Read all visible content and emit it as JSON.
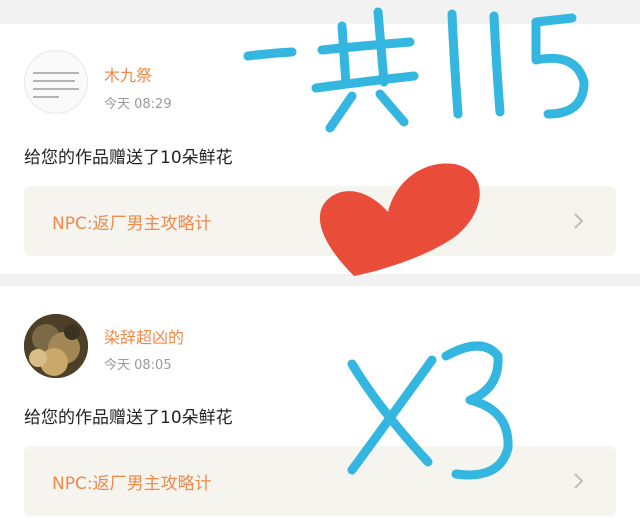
{
  "notifications": [
    {
      "username": "木九祭",
      "time": "今天 08:29",
      "message": "给您的作品赠送了10朵鲜花",
      "work_title": "NPC:返厂男主攻略计",
      "avatar_icon": "text-image-avatar"
    },
    {
      "username": "染辞超凶的",
      "time": "今天 08:05",
      "message": "给您的作品赠送了10朵鲜花",
      "work_title": "NPC:返厂男主攻略计",
      "avatar_icon": "photo-avatar"
    }
  ],
  "annotation": {
    "color": "#33b6e0",
    "heart_color": "#ea4c3a",
    "icons": [
      "handwritten-total-115",
      "heart-icon",
      "handwritten-x3"
    ]
  },
  "colors": {
    "accent": "#f08a4b",
    "card_bg": "#f5f4ef",
    "separator": "#f2f2f2"
  }
}
